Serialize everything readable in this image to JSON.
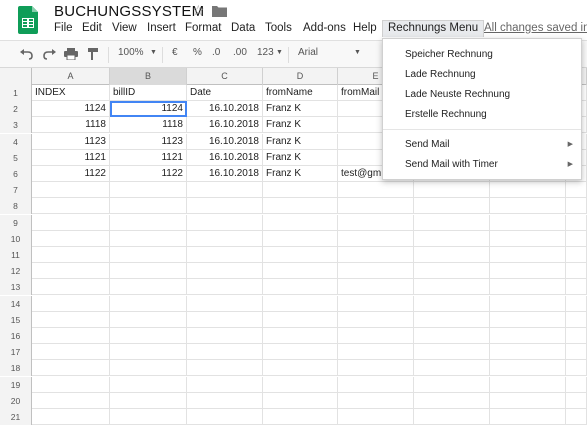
{
  "app": {
    "title": "BUCHUNGSSYSTEM",
    "star_icon": "star-icon",
    "folder_icon": "folder-icon",
    "saved_status": "All changes saved in D"
  },
  "menubar": {
    "items": [
      "File",
      "Edit",
      "View",
      "Insert",
      "Format",
      "Data",
      "Tools",
      "Add-ons",
      "Help",
      "Rechnungs Menu"
    ]
  },
  "toolbar": {
    "zoom": "100%",
    "currency": "€",
    "percent": "%",
    "decimal_decrease": ".0",
    "decimal_increase": ".00",
    "number_format": "123",
    "font": "Arial"
  },
  "grid": {
    "columns": [
      "A",
      "B",
      "C",
      "D",
      "E"
    ],
    "rows": [
      [
        "INDEX",
        "billID",
        "Date",
        "fromName",
        "fromMail"
      ],
      [
        "1124",
        "1124",
        "16.10.2018",
        "Franz K",
        ""
      ],
      [
        "1118",
        "1118",
        "16.10.2018",
        "Franz K",
        ""
      ],
      [
        "1123",
        "1123",
        "16.10.2018",
        "Franz K",
        ""
      ],
      [
        "1121",
        "1121",
        "16.10.2018",
        "Franz K",
        ""
      ],
      [
        "1122",
        "1122",
        "16.10.2018",
        "Franz K",
        "test@gm"
      ]
    ],
    "row_numbers": [
      "1",
      "2",
      "3",
      "4",
      "5",
      "6",
      "7",
      "8",
      "9",
      "10",
      "11",
      "12",
      "13",
      "14",
      "15",
      "16",
      "17",
      "18",
      "19",
      "20",
      "21"
    ]
  },
  "dropdown": {
    "items": [
      "Speicher Rechnung",
      "Lade Rechnung",
      "Lade Neuste Rechnung",
      "Erstelle Rechnung",
      "Send Mail",
      "Send Mail with Timer"
    ]
  },
  "colors": {
    "sheets_green": "#0f9d58",
    "selection_blue": "#4285f4",
    "header_gray": "#f3f3f3"
  }
}
